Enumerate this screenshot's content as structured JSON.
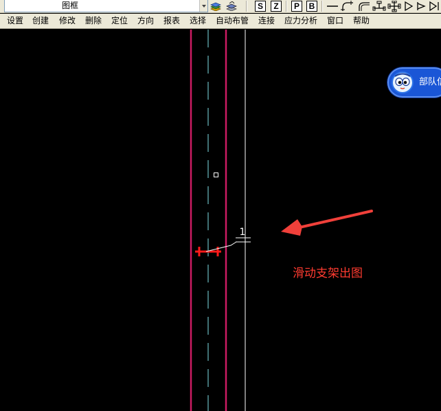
{
  "toolbar": {
    "layer_name": "图框",
    "letter_buttons": [
      "S",
      "Z",
      "P",
      "B"
    ]
  },
  "menu": {
    "items": [
      "设置",
      "创建",
      "修改",
      "删除",
      "定位",
      "方向",
      "报表",
      "选择",
      "自动布管",
      "连接",
      "应力分析",
      "窗口",
      "帮助"
    ]
  },
  "canvas": {
    "node_number": "1",
    "annotation": "滑动支架出图",
    "colors": {
      "background": "#000000",
      "pipe_outline": "#cc1b63",
      "center_line": "#7fe0e8",
      "arrow": "#f0403a",
      "support": "#ff1a1a"
    }
  },
  "assistant": {
    "label": "部队信息"
  }
}
